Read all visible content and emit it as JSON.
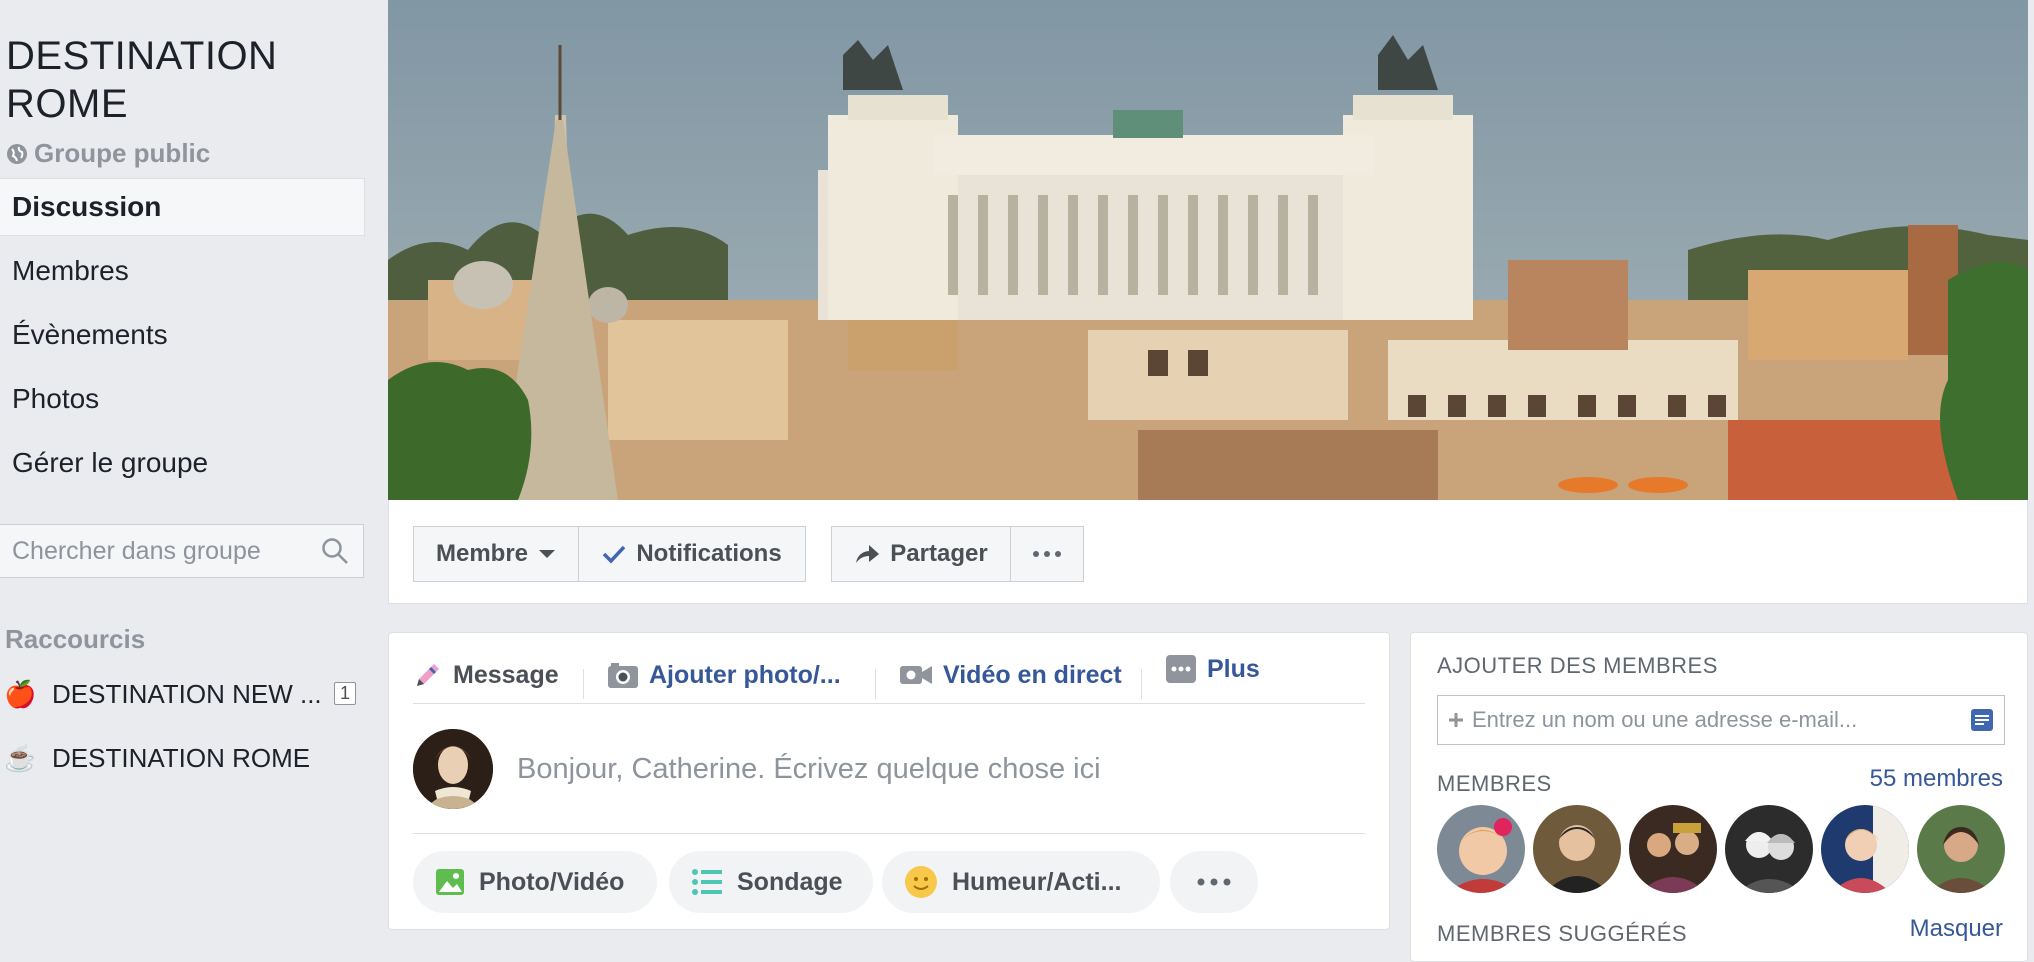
{
  "group": {
    "name_line1": "DESTINATION",
    "name_line2": "ROME",
    "privacy": "Groupe public"
  },
  "nav": {
    "items": [
      {
        "label": "Discussion",
        "active": true
      },
      {
        "label": "Membres"
      },
      {
        "label": "Évènements"
      },
      {
        "label": "Photos"
      },
      {
        "label": "Gérer le groupe"
      }
    ]
  },
  "search": {
    "placeholder": "Chercher dans groupe"
  },
  "shortcuts": {
    "title": "Raccourcis",
    "items": [
      {
        "emoji": "🍎",
        "label": "DESTINATION NEW ...",
        "badge": "1"
      },
      {
        "emoji": "☕",
        "label": "DESTINATION ROME"
      }
    ]
  },
  "actions": {
    "member": "Membre",
    "notifications": "Notifications",
    "share": "Partager"
  },
  "composer": {
    "tabs": [
      {
        "label": "Message",
        "icon": "pencil-icon"
      },
      {
        "label": "Ajouter photo/...",
        "icon": "camera-icon"
      },
      {
        "label": "Vidéo en direct",
        "icon": "video-camera-icon"
      },
      {
        "label": "Plus",
        "icon": "more-icon"
      }
    ],
    "placeholder": "Bonjour, Catherine. Écrivez quelque chose ici",
    "pills": [
      {
        "label": "Photo/Vidéo",
        "icon": "photo-icon"
      },
      {
        "label": "Sondage",
        "icon": "poll-icon"
      },
      {
        "label": "Humeur/Acti...",
        "icon": "smiley-icon"
      }
    ]
  },
  "add_members": {
    "title": "AJOUTER DES MEMBRES",
    "input_placeholder": "Entrez un nom ou une adresse e-mail...",
    "members_title": "MEMBRES",
    "members_count": "55 membres",
    "suggested_title": "MEMBRES SUGGÉRÉS",
    "hide_link": "Masquer"
  },
  "colors": {
    "link": "#365899",
    "background": "#e9ebee",
    "check": "#4267b2"
  }
}
